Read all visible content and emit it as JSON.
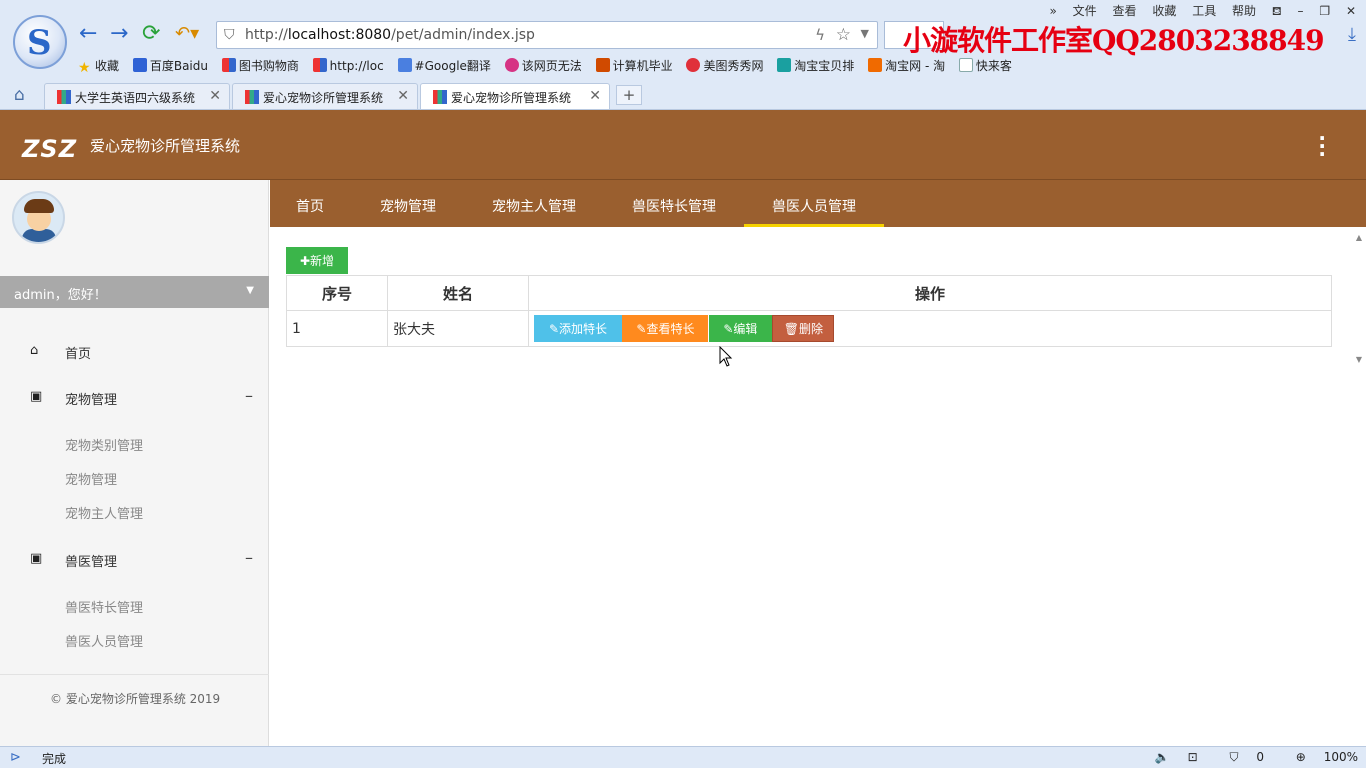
{
  "browser": {
    "url_prefix": "http://",
    "url_host": "localhost:8080",
    "url_path": "/pet/admin/index.jsp",
    "watermark": "小漩软件工作室QQ2803238849",
    "menu": [
      "文件",
      "查看",
      "收藏",
      "工具",
      "帮助"
    ],
    "favorites": [
      "收藏",
      "百度Baidu",
      "图书购物商",
      "http://loc",
      "#Google翻译",
      "该网页无法",
      "计算机毕业",
      "美图秀秀网",
      "淘宝宝贝排",
      "淘宝网 - 淘",
      "快来客"
    ],
    "tabs": [
      "大学生英语四六级系统",
      "爱心宠物诊所管理系统",
      "爱心宠物诊所管理系统"
    ],
    "new_tab": "+",
    "status_text": "完成",
    "status_count": "0",
    "zoom": "100%"
  },
  "header": {
    "logo_text": "ZSZ",
    "title": "爱心宠物诊所管理系统"
  },
  "sidebar": {
    "greeting": "admin，您好！",
    "home": "首页",
    "group1": {
      "label": "宠物管理",
      "items": [
        "宠物类别管理",
        "宠物管理",
        "宠物主人管理"
      ]
    },
    "group2": {
      "label": "兽医管理",
      "items": [
        "兽医特长管理",
        "兽医人员管理"
      ]
    },
    "copyright": "© 爱心宠物诊所管理系统 2019"
  },
  "content_tabs": [
    "首页",
    "宠物管理",
    "宠物主人管理",
    "兽医特长管理",
    "兽医人员管理"
  ],
  "active_tab": 4,
  "main": {
    "add_button": "新增",
    "columns": [
      "序号",
      "姓名",
      "操作"
    ],
    "rows": [
      {
        "id": "1",
        "name": "张大夫"
      }
    ],
    "actions": [
      "添加特长",
      "查看特长",
      "编辑",
      "删除"
    ]
  }
}
